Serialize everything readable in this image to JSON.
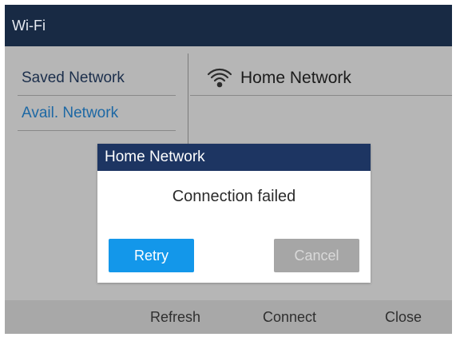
{
  "window": {
    "title": "Wi-Fi"
  },
  "sidebar": {
    "items": [
      {
        "label": "Saved Network"
      },
      {
        "label": "Avail. Network"
      }
    ]
  },
  "network_list": {
    "items": [
      {
        "name": "Home Network",
        "icon": "wifi-icon"
      }
    ]
  },
  "dialog": {
    "title": "Home Network",
    "message": "Connection failed",
    "retry_label": "Retry",
    "cancel_label": "Cancel"
  },
  "toolbar": {
    "refresh_label": "Refresh",
    "connect_label": "Connect",
    "close_label": "Close"
  },
  "colors": {
    "titlebar": "#182a44",
    "dialog_title": "#1d3562",
    "retry_button": "#1397ea",
    "cancel_button": "#a6a6a6",
    "content_background": "#d0d0d0",
    "bottom_bar": "#a8a8a8",
    "selected_sidebar_text": "#2277bb"
  }
}
